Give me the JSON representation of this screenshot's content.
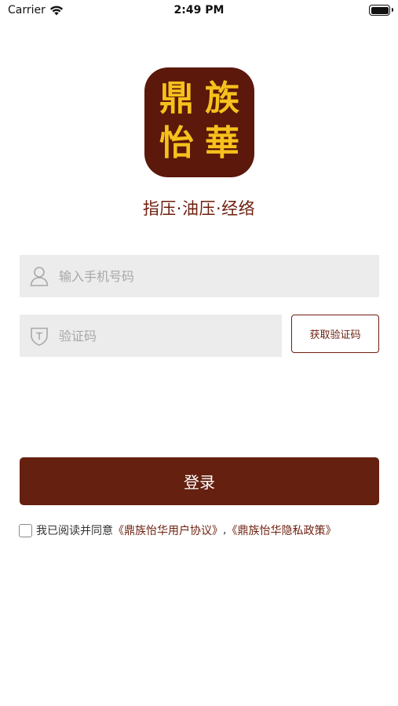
{
  "status_bar": {
    "carrier": "Carrier",
    "time": "2:49 PM"
  },
  "logo": {
    "chars": [
      "鼎",
      "族",
      "怡",
      "華"
    ]
  },
  "slogan": "指压·油压·经络",
  "phone_input": {
    "placeholder": "输入手机号码",
    "value": ""
  },
  "code_input": {
    "placeholder": "验证码",
    "value": ""
  },
  "get_code_label": "获取验证码",
  "login_label": "登录",
  "agreement": {
    "checked": false,
    "prefix": "我已阅读并同意",
    "user_agreement": "《鼎族怡华用户协议》",
    "separator": ",",
    "privacy_policy": "《鼎族怡华隐私政策》"
  },
  "colors": {
    "brand": "#65200f",
    "logo_gold": "#f6c11c",
    "field_bg": "#ececec"
  },
  "icons": {
    "phone_field": "user-icon",
    "code_field": "shield-icon"
  }
}
